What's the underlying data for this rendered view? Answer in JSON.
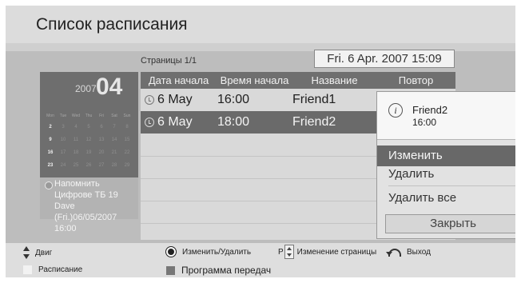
{
  "header": {
    "title": "Список расписания"
  },
  "pages": {
    "label": "Страницы 1/1"
  },
  "datetime": "Fri. 6 Apr. 2007 15:09",
  "calendar": {
    "year": "2007",
    "month": "04",
    "weekdays": [
      "Mon",
      "Tue",
      "Wed",
      "Thu",
      "Fri",
      "Sat",
      "Sun"
    ],
    "weeks": [
      [
        "2",
        "3",
        "4",
        "5",
        "6",
        "7",
        "8"
      ],
      [
        "9",
        "10",
        "11",
        "12",
        "13",
        "14",
        "15"
      ],
      [
        "16",
        "17",
        "18",
        "19",
        "20",
        "21",
        "22"
      ],
      [
        "23",
        "24",
        "25",
        "26",
        "27",
        "28",
        "29"
      ]
    ],
    "reminder": {
      "title": "Напомнить",
      "channel": "Цифрове ТБ 19",
      "name": "Dave",
      "date": "(Fri.)06/05/2007",
      "time": "16:00"
    }
  },
  "table": {
    "columns": [
      "Дата начала",
      "Время начала",
      "Название",
      "Повтор"
    ],
    "rows": [
      {
        "date": "6 May",
        "time": "16:00",
        "name": "Friend1"
      },
      {
        "date": "6 May",
        "time": "18:00",
        "name": "Friend2"
      }
    ]
  },
  "popup": {
    "name": "Friend2",
    "time": "16:00",
    "items": [
      "Изменить",
      "Удалить",
      "Удалить все"
    ],
    "close": "Закрыть"
  },
  "footer": {
    "move": "Двиг",
    "edit_delete": "Изменить/Удалить",
    "page_prefix": "P",
    "page_change": "Изменение страницы",
    "exit": "Выход",
    "schedule": "Расписание",
    "guide": "Программа передач"
  },
  "colors": {
    "schedule_swatch": "#f2f2f2",
    "guide_swatch": "#777777"
  }
}
